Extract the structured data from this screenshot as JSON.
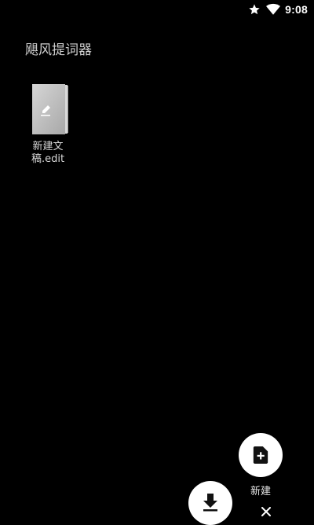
{
  "status_bar": {
    "time": "9:08",
    "icons": [
      "star-icon",
      "wifi-icon"
    ]
  },
  "app": {
    "title": "飓风提词器"
  },
  "files": [
    {
      "name": "新建文稿.edit",
      "icon": "document-edit-icon"
    }
  ],
  "fab_menu": {
    "new_label": "新建",
    "new_icon": "new-document-icon",
    "import_icon": "download-icon",
    "close_icon": "close-icon"
  },
  "colors": {
    "background": "#000000",
    "fab_background": "#ffffff",
    "text": "#d8d8d8"
  }
}
